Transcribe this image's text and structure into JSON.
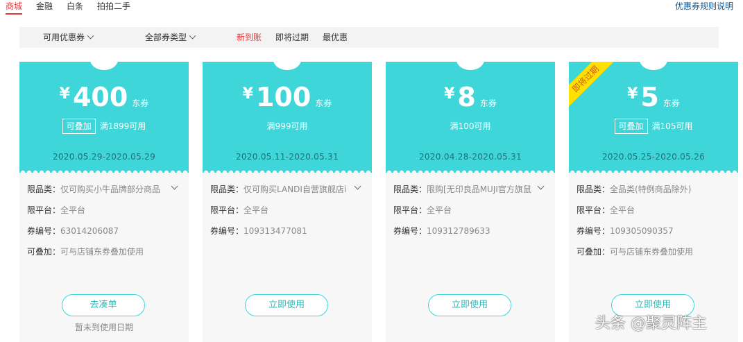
{
  "nav": {
    "tabs": [
      "商城",
      "金融",
      "白条",
      "拍拍二手"
    ],
    "active_index": 0,
    "rules_link": "优惠券规则说明"
  },
  "filters": {
    "available": "可用优惠券",
    "all_types": "全部券类型",
    "new_arrivals": "新到账",
    "expiring": "即将过期",
    "best_deal": "最优惠"
  },
  "colors": {
    "accent_red": "#e4393c",
    "coupon_teal": "#3ed6d9",
    "ribbon_yellow": "#ffe000"
  },
  "coupons": [
    {
      "currency": "¥",
      "amount": "400",
      "unit": "东券",
      "stack_badge": "可叠加",
      "condition": "满1899可用",
      "dates": "2020.05.29-2020.05.29",
      "category_label": "限品类：",
      "category": "仅可购买小牛品牌部分商品",
      "platform_label": "限平台：",
      "platform": "全平台",
      "code_label": "券编号：",
      "code": "63014206087",
      "stack_label": "可叠加：",
      "stack_note": "可与店铺东券叠加使用",
      "button": "去凑单",
      "note": "暂未到使用日期"
    },
    {
      "currency": "¥",
      "amount": "100",
      "unit": "东券",
      "condition": "满999可用",
      "dates": "2020.05.11-2020.05.31",
      "category_label": "限品类：",
      "category": "仅可购买LANDI自营旗舰店i",
      "platform_label": "限平台：",
      "platform": "全平台",
      "code_label": "券编号：",
      "code": "109313477081",
      "button": "立即使用"
    },
    {
      "currency": "¥",
      "amount": "8",
      "unit": "东券",
      "condition": "满100可用",
      "dates": "2020.04.28-2020.05.31",
      "category_label": "限品类：",
      "category": "限购[无印良品MUJI官方旗鼠",
      "platform_label": "限平台：",
      "platform": "全平台",
      "code_label": "券编号：",
      "code": "109312789633",
      "button": "立即使用"
    },
    {
      "ribbon": "即将过期",
      "currency": "¥",
      "amount": "5",
      "unit": "东券",
      "stack_badge": "可叠加",
      "condition": "满105可用",
      "dates": "2020.05.25-2020.05.26",
      "category_label": "限品类：",
      "category": "全品类(特例商品除外)",
      "platform_label": "限平台：",
      "platform": "全平台",
      "code_label": "券编号：",
      "code": "109305090357",
      "stack_label": "可叠加：",
      "stack_note": "可与店铺东券叠加使用",
      "button": "立即使用"
    }
  ],
  "watermark": "头条 @聚灵阵主"
}
